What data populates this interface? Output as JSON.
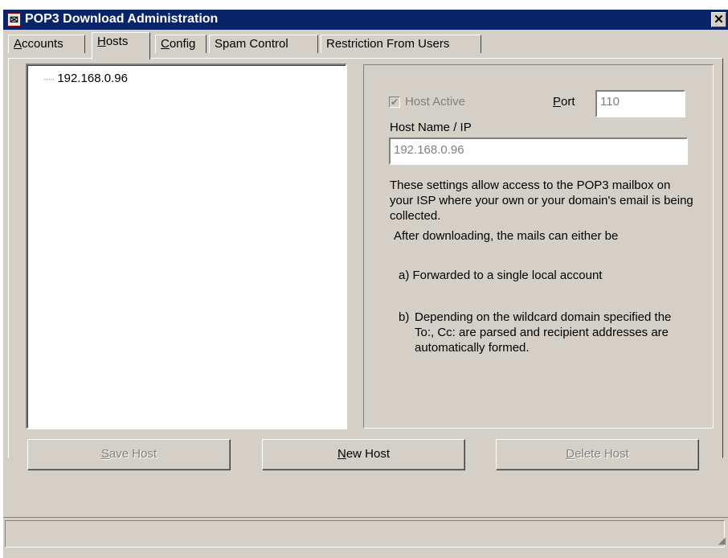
{
  "window": {
    "title": "POP3 Download Administration",
    "close_glyph": "✕",
    "icon": "pop3-app-icon"
  },
  "tabs": [
    {
      "label_u": "A",
      "label_rest": "ccounts",
      "active": false
    },
    {
      "label_u": "H",
      "label_rest": "osts",
      "active": true
    },
    {
      "label_u": "C",
      "label_rest": "onfig",
      "active": false
    },
    {
      "label_u": "",
      "label_rest": "Spam Control",
      "active": false
    },
    {
      "label_u": "",
      "label_rest": "Restriction From Users",
      "active": false
    }
  ],
  "host_list": {
    "items": [
      "192.168.0.96"
    ]
  },
  "settings": {
    "host_active_label": "Host Active",
    "host_active_checked": true,
    "port_label_u": "P",
    "port_label_rest": "ort",
    "port_value": "110",
    "hostname_label": "Host Name / IP",
    "hostname_value": "192.168.0.96",
    "description": "These settings allow access to the POP3 mailbox on your ISP where your own or your domain's email is being collected.",
    "after_text": "After downloading, the mails can either be",
    "option_a": "a) Forwarded to a single local account",
    "option_b_letter": "b)",
    "option_b_text": "Depending on the wildcard domain specified the To:, Cc: are parsed and recipient addresses are automatically formed."
  },
  "buttons": {
    "save_u": "S",
    "save_rest": "ave Host",
    "new_u": "N",
    "new_rest": "ew Host",
    "delete_u": "D",
    "delete_rest": "elete Host"
  },
  "colors": {
    "titlebar": "#0a246a",
    "face": "#d4d0c8",
    "disabled_text": "#808080"
  }
}
